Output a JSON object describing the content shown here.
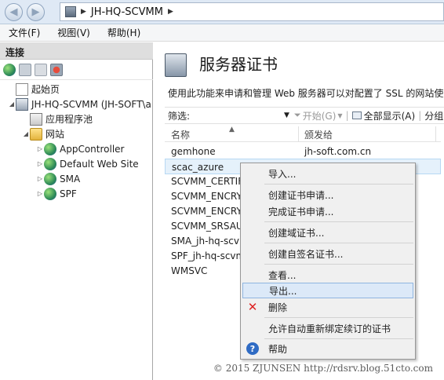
{
  "address": {
    "path": "JH-HQ-SCVMM"
  },
  "menubar": [
    {
      "label": "文件(F)"
    },
    {
      "label": "视图(V)"
    },
    {
      "label": "帮助(H)"
    }
  ],
  "connections": {
    "header": "连接",
    "tree": {
      "start_page": "起始页",
      "server": "JH-HQ-SCVMM (JH-SOFT\\a",
      "app_pools": "应用程序池",
      "sites": "网站",
      "site_items": [
        "AppController",
        "Default Web Site",
        "SMA",
        "SPF"
      ]
    }
  },
  "content": {
    "title": "服务器证书",
    "description": "使用此功能来申请和管理 Web 服务器可以对配置了 SSL 的网站使用",
    "filter": {
      "label": "筛选:",
      "start": "开始(G)",
      "show_all": "全部显示(A)",
      "group": "分组"
    },
    "table": {
      "columns": [
        "名称",
        "颁发给"
      ],
      "rows": [
        {
          "name": "gemhone",
          "issued_to": "jh-soft.com.cn"
        },
        {
          "name": "scac_azure",
          "issued_to": ""
        },
        {
          "name": "SCVMM_CERTIF",
          "issued_to": ""
        },
        {
          "name": "SCVMM_ENCRY",
          "issued_to": ""
        },
        {
          "name": "SCVMM_ENCRY",
          "issued_to": ""
        },
        {
          "name": "SCVMM_SRSAU",
          "issued_to": ""
        },
        {
          "name": "SMA_jh-hq-scvm",
          "issued_to": ""
        },
        {
          "name": "SPF_jh-hq-scvm",
          "issued_to": ""
        },
        {
          "name": "WMSVC",
          "issued_to": ""
        }
      ],
      "selected_row_index": 1
    }
  },
  "context_menu": {
    "items": [
      {
        "label": "导入..."
      },
      {
        "label": "创建证书申请..."
      },
      {
        "label": "完成证书申请..."
      },
      {
        "label": "创建域证书..."
      },
      {
        "label": "创建自签名证书..."
      },
      {
        "label": "查看..."
      },
      {
        "label": "导出..."
      },
      {
        "label": "删除"
      },
      {
        "label": "允许自动重新绑定续订的证书"
      },
      {
        "label": "帮助"
      }
    ],
    "highlighted": "导出..."
  },
  "watermark": "© 2015 ZJUNSEN http://rdsrv.blog.51cto.com"
}
